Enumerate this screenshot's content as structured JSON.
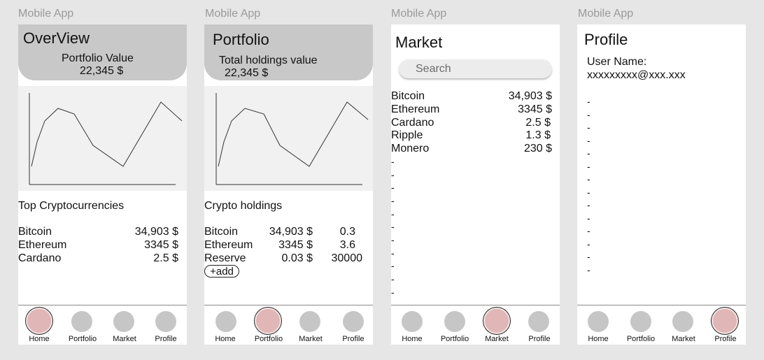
{
  "screens": [
    {
      "caption": "Mobile App",
      "title": "OverView",
      "subtitle": "Portfolio Value",
      "value": "22,345 $",
      "section_title": "Top Cryptocurrencies",
      "rows": [
        {
          "name": "Bitcoin",
          "price": "34,903 $"
        },
        {
          "name": "Ethereum",
          "price": "3345 $"
        },
        {
          "name": "Cardano",
          "price": "2.5 $"
        }
      ]
    },
    {
      "caption": "Mobile App",
      "title": "Portfolio",
      "subtitle": "Total holdings value",
      "value": "22,345 $",
      "section_title": "Crypto holdings",
      "rows": [
        {
          "name": "Bitcoin",
          "price": "34,903 $",
          "amount": "0.3"
        },
        {
          "name": "Ethereum",
          "price": "3345 $",
          "amount": "3.6"
        },
        {
          "name": "Reserve",
          "price": "0.03 $",
          "amount": "30000"
        }
      ],
      "add_label": "+add"
    },
    {
      "caption": "Mobile App",
      "title": "Market",
      "search_placeholder": "Search",
      "rows": [
        {
          "name": "Bitcoin",
          "price": "34,903 $"
        },
        {
          "name": "Ethereum",
          "price": "3345 $"
        },
        {
          "name": "Cardano",
          "price": "2.5 $"
        },
        {
          "name": "Ripple",
          "price": "1.3 $"
        },
        {
          "name": "Monero",
          "price": "230 $"
        }
      ],
      "placeholder_rows": [
        "-",
        "-",
        "-",
        "-",
        "-",
        "-",
        "-",
        "-",
        "-",
        "-",
        "-"
      ]
    },
    {
      "caption": "Mobile App",
      "title": "Profile",
      "user_label": "User Name:",
      "email": "xxxxxxxxx@xxx.xxx",
      "placeholder_rows": [
        "-",
        "-",
        "-",
        "-",
        "-",
        "-",
        "-",
        "-",
        "-",
        "-",
        "-",
        "-",
        "-",
        "-"
      ]
    }
  ],
  "nav": {
    "items": [
      "Home",
      "Portfolio",
      "Market",
      "Profile"
    ],
    "active_by_screen": [
      "Home",
      "Portfolio",
      "Market",
      "Profile"
    ]
  },
  "colors": {
    "background": "#e6e6e6",
    "header": "#c8c8c8",
    "chart_bg": "#f1f1f1",
    "nav_inactive": "#c6c6c6",
    "nav_active": "#e0b6b6"
  }
}
